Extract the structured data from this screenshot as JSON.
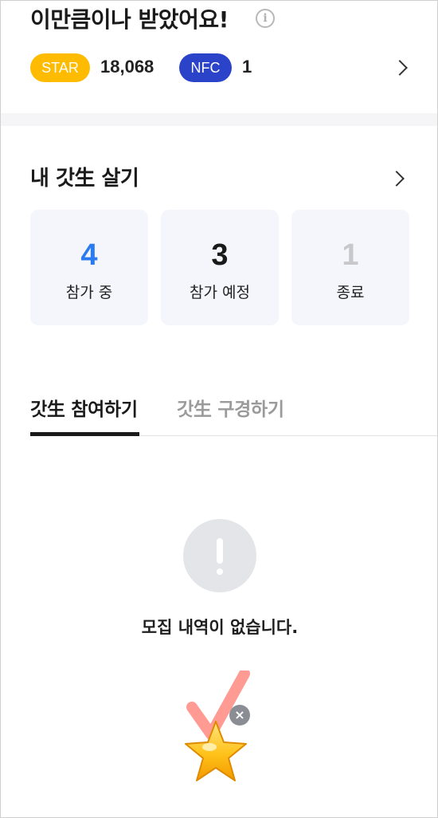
{
  "reward": {
    "title": "이만큼이나 받았어요!",
    "info_icon": "i",
    "star_label": "STAR",
    "star_count": "18,068",
    "nfc_label": "NFC",
    "nfc_count": "1"
  },
  "my_section": {
    "title": "내 갓生 살기",
    "stats": [
      {
        "value": "4",
        "label": "참가 중",
        "color": "#2b7bf0"
      },
      {
        "value": "3",
        "label": "참가 예정",
        "color": "#1a1a1a"
      },
      {
        "value": "1",
        "label": "종료",
        "color": "#c8c8cc"
      }
    ]
  },
  "tabs": [
    {
      "label": "갓生 참여하기",
      "active": true
    },
    {
      "label": "갓生 구경하기",
      "active": false
    }
  ],
  "empty_state": {
    "message": "모집 내역이 없습니다.",
    "icon": "exclamation-icon"
  },
  "floating": {
    "icon": "star-check-icon",
    "close_icon": "×"
  },
  "colors": {
    "star_badge": "#ffbb00",
    "nfc_badge": "#2a43c9",
    "accent": "#2b7bf0"
  }
}
